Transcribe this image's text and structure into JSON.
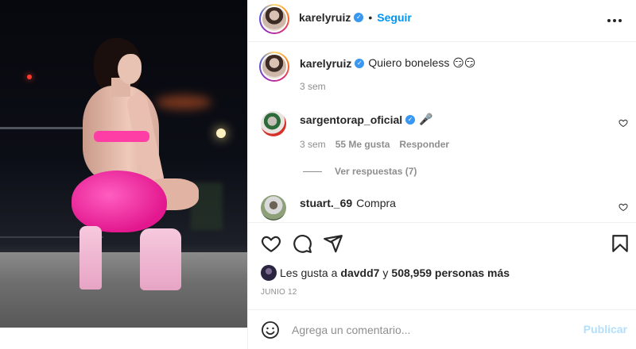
{
  "post": {
    "author": "karelyruiz",
    "follow_label": "Seguir",
    "dot": "•",
    "caption": {
      "username": "karelyruiz",
      "text": "Quiero boneless 😏😏",
      "time": "3 sem"
    }
  },
  "comments": [
    {
      "username": "sargentorap_oficial",
      "verified": true,
      "text": "🎤",
      "time": "3 sem",
      "likes": "55 Me gusta",
      "reply_label": "Responder",
      "view_replies": "Ver respuestas (7)"
    },
    {
      "username": "stuart._69",
      "verified": false,
      "text": "Compra"
    }
  ],
  "likes": {
    "prefix": "Les gusta a",
    "user": "davdd7",
    "connector": "y",
    "count": "508,959 personas más"
  },
  "date": "JUNIO 12",
  "comment_box": {
    "placeholder": "Agrega un comentario...",
    "publish_label": "Publicar"
  },
  "icons": [
    "verified-badge-icon",
    "more-options-icon",
    "heart-icon",
    "comment-icon",
    "share-icon",
    "bookmark-icon",
    "emoji-icon"
  ],
  "colors": {
    "follow_blue": "#0095f6",
    "verified_blue": "#3897f0",
    "publish_disabled": "#b2dffc",
    "muted_text": "#8e8e8e"
  }
}
